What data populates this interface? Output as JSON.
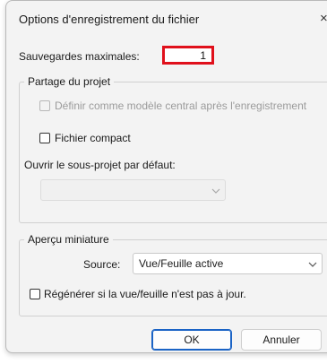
{
  "window": {
    "title": "Options d'enregistrement du fichier",
    "close_glyph": "×"
  },
  "max_backups": {
    "label": "Sauvegardes maximales:",
    "value": "1"
  },
  "worksharing": {
    "legend": "Partage du projet",
    "central_model_label": "Définir comme modèle central après l'enregistrement",
    "central_model_checked": false,
    "central_model_enabled": false,
    "compact_label": "Fichier compact",
    "compact_checked": false,
    "open_workset_label": "Ouvrir le sous-projet par défaut:",
    "open_workset_value": ""
  },
  "thumbnail": {
    "legend": "Aperçu miniature",
    "source_label": "Source:",
    "source_value": "Vue/Feuille active",
    "regenerate_label": "Régénérer si la vue/feuille n'est pas à jour.",
    "regenerate_checked": false
  },
  "buttons": {
    "ok": "OK",
    "cancel": "Annuler"
  },
  "colors": {
    "highlight": "#e0101b",
    "primary_border": "#1a63c5"
  },
  "icons": {
    "close": "close-icon",
    "dropdown": "chevron-down-icon"
  }
}
